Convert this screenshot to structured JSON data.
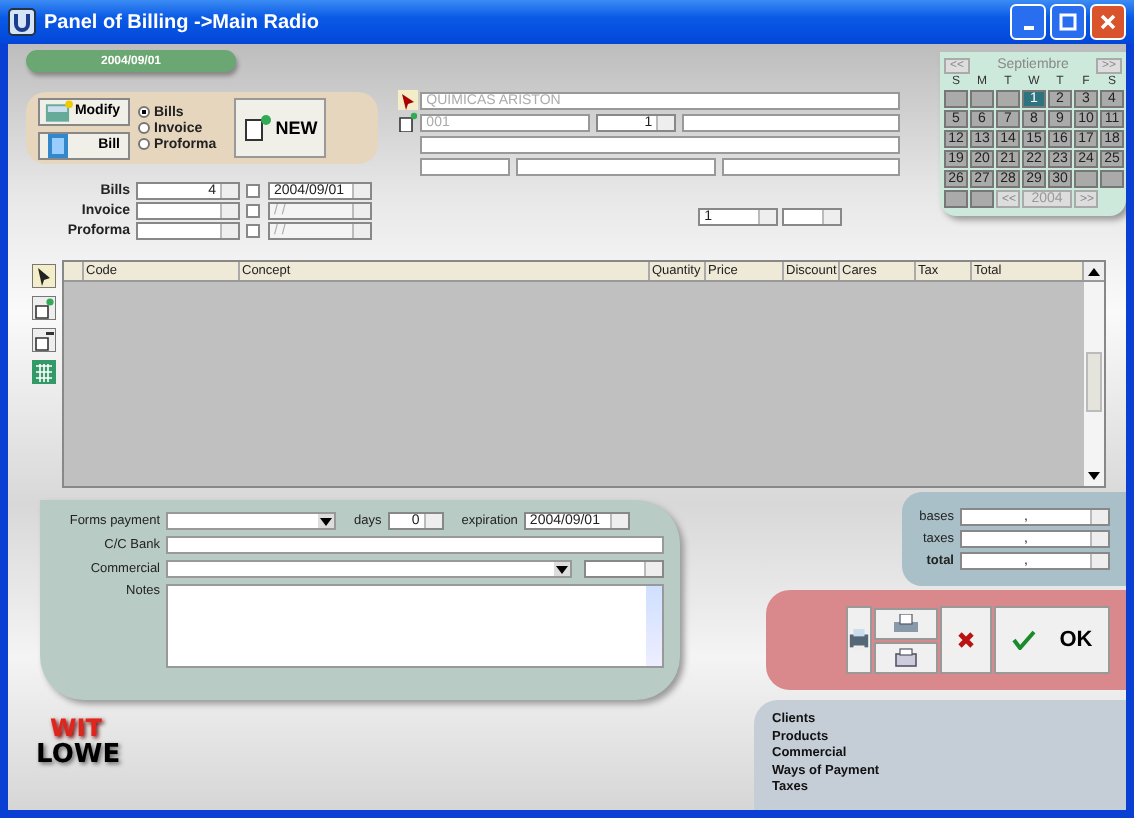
{
  "window": {
    "title": "Panel of Billing ->Main Radio"
  },
  "date_badge": "2004/09/01",
  "actions": [
    {
      "label": "Modify",
      "kind": "modify"
    },
    {
      "label": "Bill",
      "kind": "bill"
    }
  ],
  "doc_types": [
    {
      "label": "Bills",
      "selected": true
    },
    {
      "label": "Invoice",
      "selected": false
    },
    {
      "label": "Proforma",
      "selected": false
    }
  ],
  "new_button": "NEW",
  "numbering": [
    {
      "label": "Bills",
      "number": "4",
      "checked": false,
      "date": "2004/09/01",
      "disabled": false
    },
    {
      "label": "Invoice",
      "checked": false,
      "date": " /  /",
      "disabled": true
    },
    {
      "label": "Proforma",
      "checked": false,
      "date": " /  /",
      "disabled": true
    }
  ],
  "client": {
    "name": "QUIMICAS ARISTON",
    "code": "001",
    "count": "1"
  },
  "line_entry": {
    "quantity": "1"
  },
  "calendar": {
    "prev": "<<",
    "month": "Septiembre",
    "next": ">>",
    "weekdays": [
      "S",
      "M",
      "T",
      "W",
      "T",
      "F",
      "S"
    ],
    "days": [
      {
        "day": "1",
        "selected": true
      },
      {
        "day": "2",
        "selected": false
      },
      {
        "day": "3",
        "selected": false
      },
      {
        "day": "4",
        "selected": false
      },
      {
        "day": "5",
        "selected": false
      },
      {
        "day": "6",
        "selected": false
      },
      {
        "day": "7",
        "selected": false
      },
      {
        "day": "8",
        "selected": false
      },
      {
        "day": "9",
        "selected": false
      },
      {
        "day": "10",
        "selected": false
      },
      {
        "day": "11",
        "selected": false
      },
      {
        "day": "12",
        "selected": false
      },
      {
        "day": "13",
        "selected": false
      },
      {
        "day": "14",
        "selected": false
      },
      {
        "day": "15",
        "selected": false
      },
      {
        "day": "16",
        "selected": false
      },
      {
        "day": "17",
        "selected": false
      },
      {
        "day": "18",
        "selected": false
      },
      {
        "day": "19",
        "selected": false
      },
      {
        "day": "20",
        "selected": false
      },
      {
        "day": "21",
        "selected": false
      },
      {
        "day": "22",
        "selected": false
      },
      {
        "day": "23",
        "selected": false
      },
      {
        "day": "24",
        "selected": false
      },
      {
        "day": "25",
        "selected": false
      },
      {
        "day": "26",
        "selected": false
      },
      {
        "day": "27",
        "selected": false
      },
      {
        "day": "28",
        "selected": false
      },
      {
        "day": "29",
        "selected": false
      },
      {
        "day": "30",
        "selected": false
      }
    ],
    "year_prev": "<<",
    "year": "2004",
    "year_next": ">>"
  },
  "table": {
    "columns": [
      "Code",
      "Concept",
      "Quantity",
      "Price",
      "Discount",
      "Cares",
      "Tax",
      "Total"
    ]
  },
  "payment": {
    "forms_label": "Forms payment",
    "days_label": "days",
    "days": "0",
    "expiration_label": "expiration",
    "expiration": "2004/09/01",
    "bank_label": "C/C Bank",
    "commercial_label": "Commercial",
    "notes_label": "Notes"
  },
  "totals": [
    {
      "label": "bases",
      "value": ",",
      "bold": false
    },
    {
      "label": "taxes",
      "value": ",",
      "bold": false
    },
    {
      "label": "total",
      "value": ",",
      "bold": true
    }
  ],
  "ok_button": "OK",
  "links": [
    "Clients",
    "Products",
    "Commercial",
    "Ways of Payment",
    "Taxes"
  ],
  "logo": {
    "top": "WIT",
    "bottom": "LOWE"
  }
}
